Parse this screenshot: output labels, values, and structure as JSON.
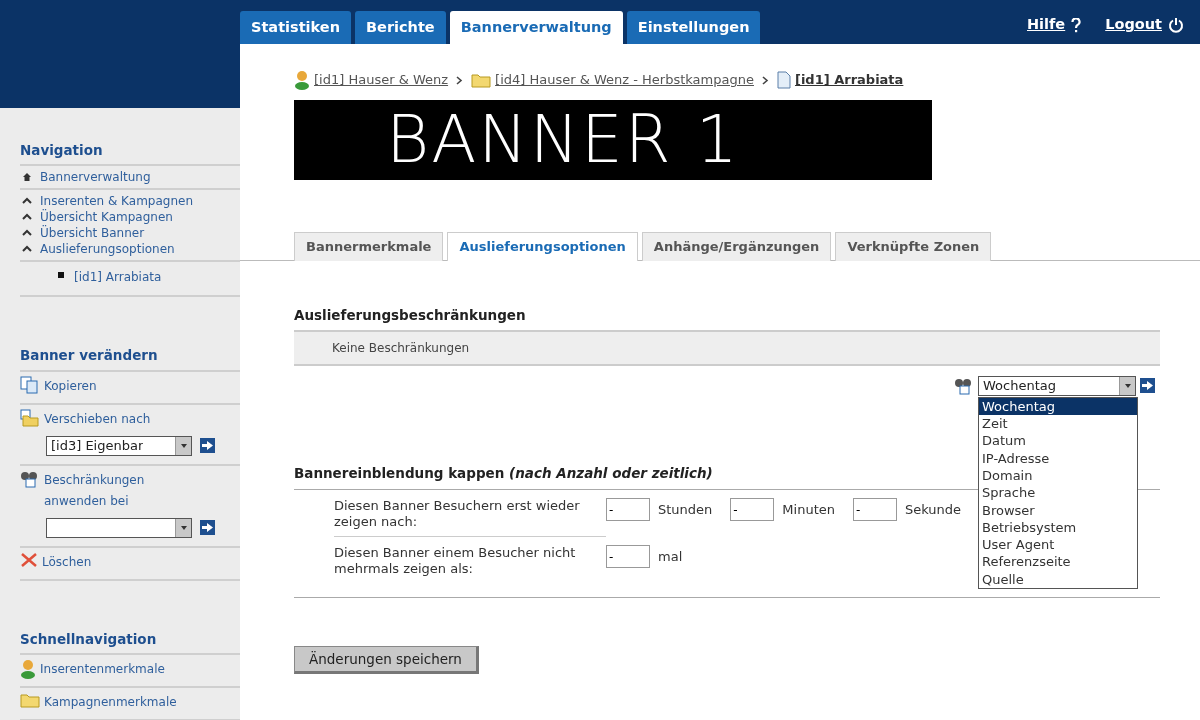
{
  "top_tabs": [
    {
      "label": "Statistiken",
      "selected": false
    },
    {
      "label": "Berichte",
      "selected": false
    },
    {
      "label": "Bannerverwaltung",
      "selected": true
    },
    {
      "label": "Einstellungen",
      "selected": false
    }
  ],
  "header_links": [
    {
      "label": "Hilfe",
      "kind": "help"
    },
    {
      "label": "Logout",
      "kind": "power"
    }
  ],
  "sidebar": {
    "sections": [
      {
        "title": "Navigation",
        "kind": "nav",
        "groups": [
          [
            {
              "label": "Bannerverwaltung",
              "kind": "home"
            }
          ],
          [
            {
              "label": "Inserenten & Kampagnen",
              "kind": "up"
            },
            {
              "label": "Übersicht Kampagnen",
              "kind": "up"
            },
            {
              "label": "Übersicht Banner",
              "kind": "up"
            },
            {
              "label": "Auslieferungsoptionen",
              "kind": "up",
              "children": [
                {
                  "label": "[id1] Arrabiata",
                  "kind": "bullet"
                }
              ]
            }
          ]
        ]
      },
      {
        "title": "Banner verändern",
        "kind": "actions",
        "items": [
          {
            "label": "Kopieren",
            "kind": "copy",
            "dropdown": false
          },
          {
            "label": "Verschieben nach",
            "kind": "move",
            "dropdown": true,
            "select": "[id3] Eigenbar"
          },
          {
            "label": "Beschränkungen anwenden bei",
            "kind": "restrict",
            "dropdown": true
          },
          {
            "label": "Löschen",
            "kind": "delete",
            "dropdown": false
          }
        ]
      },
      {
        "title": "Schnellnavigation",
        "kind": "actions",
        "items": [
          {
            "label": "Inserentenmerkmale",
            "kind": "person",
            "dropdown": false
          },
          {
            "label": "Kampagnenmerkmale",
            "kind": "folder",
            "dropdown": false
          }
        ]
      }
    ]
  },
  "breadcrumb": [
    {
      "label": "[id1] Hauser & Wenz",
      "kind": "person"
    },
    {
      "label": "[id4] Hauser & Wenz - Herbstkampagne",
      "kind": "folder"
    },
    {
      "label": "[id1] Arrabiata",
      "kind": "page"
    }
  ],
  "banner_text": "BANNER 1",
  "sub_tabs": [
    {
      "label": "Bannermerkmale",
      "selected": false
    },
    {
      "label": "Auslieferungsoptionen",
      "selected": true
    },
    {
      "label": "Anhänge/Ergänzungen",
      "selected": false
    },
    {
      "label": "Verknüpfte Zonen",
      "selected": false
    }
  ],
  "restrictions": {
    "title": "Auslieferungsbeschränkungen",
    "empty_text": "Keine Beschränkungen",
    "select": {
      "value": "Wochentag",
      "options": [
        {
          "label": "Wochentag",
          "selected": true
        },
        {
          "label": "Zeit",
          "selected": false
        },
        {
          "label": "Datum",
          "selected": false
        },
        {
          "label": "IP-Adresse",
          "selected": false
        },
        {
          "label": "Domain",
          "selected": false
        },
        {
          "label": "Sprache",
          "selected": false
        },
        {
          "label": "Browser",
          "selected": false
        },
        {
          "label": "Betriebsystem",
          "selected": false
        },
        {
          "label": "User Agent",
          "selected": false
        },
        {
          "label": "Referenzseite",
          "selected": false
        },
        {
          "label": "Quelle",
          "selected": false
        }
      ]
    }
  },
  "capping": {
    "title": "Bannereinblendung kappen ",
    "title_note": "(nach Anzahl oder zeitlich)",
    "rows": [
      {
        "label": "Diesen Banner Besuchern erst wieder zeigen nach:",
        "fields": [
          {
            "value": "-",
            "unit": "Stunden"
          },
          {
            "value": "-",
            "unit": "Minuten"
          },
          {
            "value": "-",
            "unit": "Sekunde"
          }
        ]
      },
      {
        "label": "Diesen Banner einem Besucher nicht mehrmals zeigen als:",
        "fields": [
          {
            "value": "-",
            "unit": "mal"
          }
        ]
      }
    ]
  },
  "save_button": "Änderungen speichern"
}
